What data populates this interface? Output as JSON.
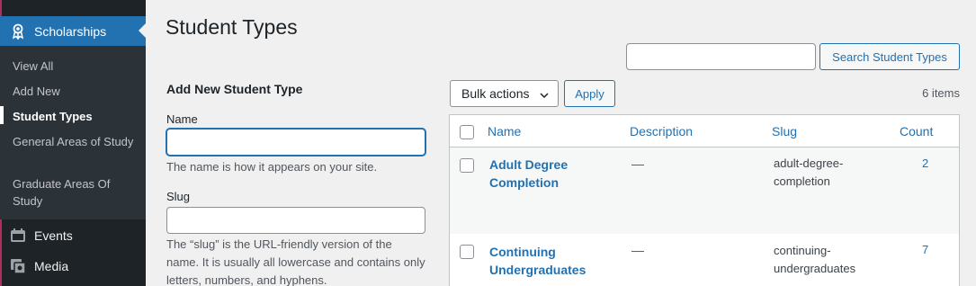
{
  "sidebar": {
    "active_menu": "Scholarships",
    "submenu": [
      "View All",
      "Add New",
      "Student Types",
      "General Areas of Study",
      "Graduate Areas Of Study"
    ],
    "current_submenu": "Student Types",
    "menu_items": [
      "Events",
      "Media"
    ]
  },
  "page": {
    "title": "Student Types"
  },
  "search": {
    "value": "",
    "button_label": "Search Student Types"
  },
  "add_form": {
    "heading": "Add New Student Type",
    "name_label": "Name",
    "name_value": "",
    "name_help": "The name is how it appears on your site.",
    "slug_label": "Slug",
    "slug_value": "",
    "slug_help": "The “slug” is the URL-friendly version of the name. It is usually all lowercase and contains only letters, numbers, and hyphens."
  },
  "bulk": {
    "selected": "Bulk actions",
    "apply_label": "Apply",
    "items_count": "6 items"
  },
  "table": {
    "columns": [
      "Name",
      "Description",
      "Slug",
      "Count"
    ],
    "rows": [
      {
        "name": "Adult Degree Completion",
        "description": "—",
        "slug": "adult-degree-completion",
        "count": "2"
      },
      {
        "name": "Continuing Undergraduates",
        "description": "—",
        "slug": "continuing-undergraduates",
        "count": "7"
      }
    ]
  },
  "colors": {
    "sidebar_bg": "#1d2327",
    "accent": "#2271b1",
    "page_bg": "#f0f0f1"
  }
}
